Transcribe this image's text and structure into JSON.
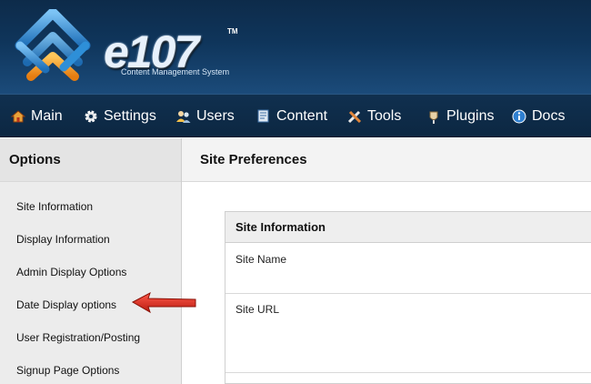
{
  "header": {
    "logo_text": "e107",
    "logo_tm": "TM",
    "logo_subtitle": "Content Management System",
    "colors": {
      "header_bg": "#0f355b",
      "logo_blue": "#2e8fd8",
      "logo_orange": "#f29418"
    }
  },
  "nav": {
    "items": [
      {
        "label": "Main",
        "icon": "house-icon"
      },
      {
        "label": "Settings",
        "icon": "gear-icon"
      },
      {
        "label": "Users",
        "icon": "users-icon"
      },
      {
        "label": "Content",
        "icon": "content-icon"
      },
      {
        "label": "Tools",
        "icon": "tools-icon"
      },
      {
        "label": "Plugins",
        "icon": "plugin-icon"
      },
      {
        "label": "Docs",
        "icon": "info-icon"
      }
    ]
  },
  "sidebar": {
    "title": "Options",
    "items": [
      {
        "label": "Site Information"
      },
      {
        "label": "Display Information"
      },
      {
        "label": "Admin Display Options"
      },
      {
        "label": "Date Display options"
      },
      {
        "label": "User Registration/Posting"
      },
      {
        "label": "Signup Page Options"
      }
    ]
  },
  "main": {
    "title": "Site Preferences",
    "panel": {
      "title": "Site Information",
      "fields": [
        {
          "label": "Site Name"
        },
        {
          "label": "Site URL"
        }
      ]
    }
  },
  "annotation": {
    "arrow_color": "#d92b20",
    "icon": "red-arrow-icon"
  }
}
